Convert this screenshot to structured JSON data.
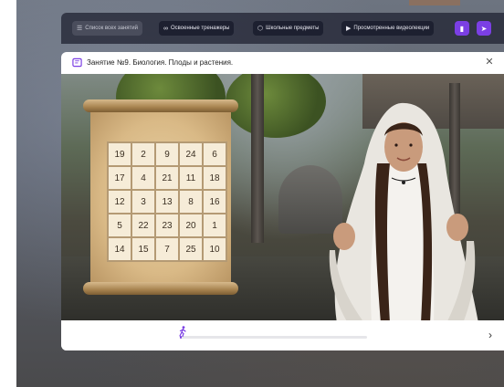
{
  "toolbar": {
    "buttons": [
      {
        "label": "Список всех занятий",
        "icon": "list-icon"
      },
      {
        "label": "Освоенные тренажеры",
        "icon": "infinity-icon"
      },
      {
        "label": "Школьные предметы",
        "icon": "cube-icon"
      },
      {
        "label": "Просмотренные видеолекции",
        "icon": "video-icon"
      }
    ],
    "icon_buttons": [
      "chart-icon",
      "send-icon"
    ]
  },
  "lesson": {
    "title": "Занятие №9. Биология. Плоды и растения.",
    "grid": [
      [
        "19",
        "2",
        "9",
        "24",
        "6"
      ],
      [
        "17",
        "4",
        "21",
        "11",
        "18"
      ],
      [
        "12",
        "3",
        "13",
        "8",
        "16"
      ],
      [
        "5",
        "22",
        "23",
        "20",
        "1"
      ],
      [
        "14",
        "15",
        "7",
        "25",
        "10"
      ]
    ]
  },
  "player": {
    "progress": 0.01,
    "progress_color": "#7b3fe4"
  },
  "colors": {
    "accent": "#7b3fe4",
    "toolbar_bg": "#222534"
  }
}
